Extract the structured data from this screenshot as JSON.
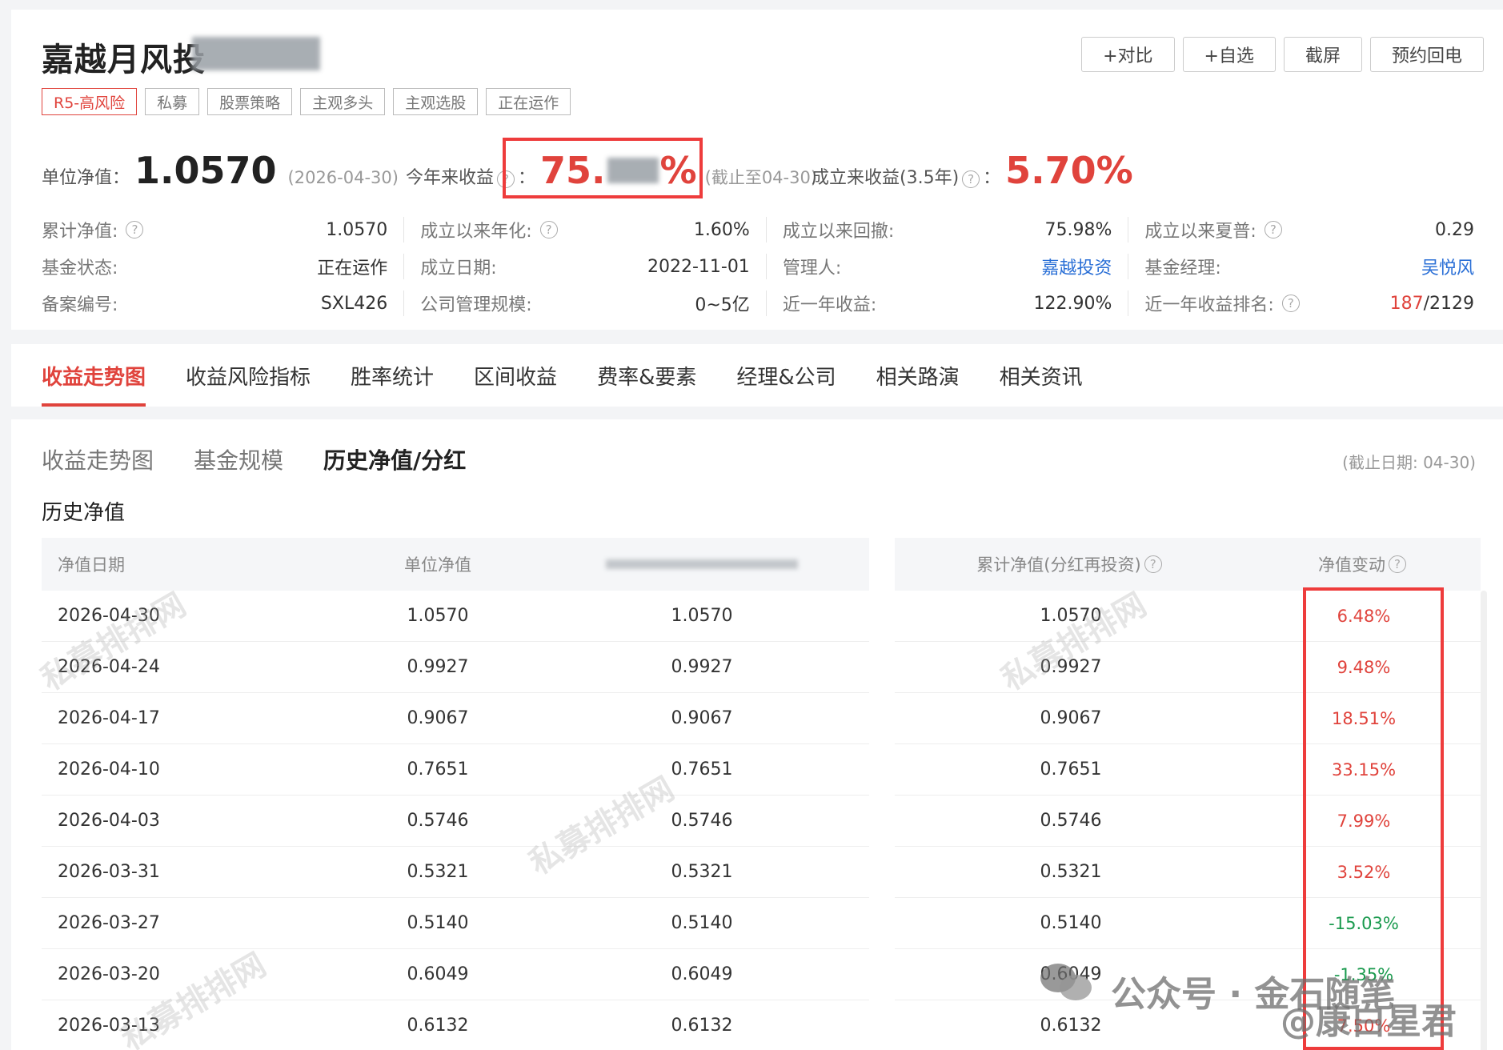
{
  "header": {
    "fund_title": "嘉越月风投",
    "buttons": [
      "+对比",
      "+自选",
      "截屏",
      "预约回电"
    ],
    "tags": [
      "R5-高风险",
      "私募",
      "股票策略",
      "主观多头",
      "主观选股",
      "正在运作"
    ]
  },
  "summary": {
    "nav_label": "单位净值：",
    "nav_value": "1.0570",
    "nav_date": "(2026-04-30)",
    "ytd_label": "今年来收益",
    "ytd_value_prefix": "75.",
    "ytd_value_suffix": "%",
    "ytd_date": "(截止至04-30)",
    "since_label": "成立来收益(3.5年)",
    "since_value": "5.70%",
    "colon": "："
  },
  "stats": [
    [
      {
        "k": "累计净值:",
        "v": "1.0570",
        "q": true
      },
      {
        "k": "成立以来年化:",
        "v": "1.60%",
        "q": true,
        "color": "red"
      },
      {
        "k": "成立以来回撤:",
        "v": "75.98%"
      },
      {
        "k": "成立以来夏普:",
        "v": "0.29",
        "q": true
      }
    ],
    [
      {
        "k": "基金状态:",
        "v": "正在运作"
      },
      {
        "k": "成立日期:",
        "v": "2022-11-01"
      },
      {
        "k": "管理人:",
        "v": "嘉越投资",
        "color": "link"
      },
      {
        "k": "基金经理:",
        "v": "吴悦风",
        "color": "link"
      }
    ],
    [
      {
        "k": "备案编号:",
        "v": "SXL426"
      },
      {
        "k": "公司管理规模:",
        "v": "0~5亿"
      },
      {
        "k": "近一年收益:",
        "v": "122.90%",
        "color": "red"
      },
      {
        "k": "近一年收益排名:",
        "v_red": "187",
        "v_rest": "/2129",
        "q": true
      }
    ]
  ],
  "tabs": [
    "收益走势图",
    "收益风险指标",
    "胜率统计",
    "区间收益",
    "费率&要素",
    "经理&公司",
    "相关路演",
    "相关资讯"
  ],
  "subtabs": [
    "收益走势图",
    "基金规模",
    "历史净值/分红"
  ],
  "asof": "(截止日期: 04-30)",
  "section_title": "历史净值",
  "table": {
    "headers": {
      "date": "净值日期",
      "nav": "单位净值",
      "acc": "累计净值(分红再投资)",
      "chg": "净值变动"
    },
    "rows": [
      {
        "date": "2026-04-30",
        "nav": "1.0570",
        "nav2": "1.0570",
        "acc": "1.0570",
        "chg": "6.48%",
        "dir": "up"
      },
      {
        "date": "2026-04-24",
        "nav": "0.9927",
        "nav2": "0.9927",
        "acc": "0.9927",
        "chg": "9.48%",
        "dir": "up"
      },
      {
        "date": "2026-04-17",
        "nav": "0.9067",
        "nav2": "0.9067",
        "acc": "0.9067",
        "chg": "18.51%",
        "dir": "up"
      },
      {
        "date": "2026-04-10",
        "nav": "0.7651",
        "nav2": "0.7651",
        "acc": "0.7651",
        "chg": "33.15%",
        "dir": "up"
      },
      {
        "date": "2026-04-03",
        "nav": "0.5746",
        "nav2": "0.5746",
        "acc": "0.5746",
        "chg": "7.99%",
        "dir": "up"
      },
      {
        "date": "2026-03-31",
        "nav": "0.5321",
        "nav2": "0.5321",
        "acc": "0.5321",
        "chg": "3.52%",
        "dir": "up"
      },
      {
        "date": "2026-03-27",
        "nav": "0.5140",
        "nav2": "0.5140",
        "acc": "0.5140",
        "chg": "-15.03%",
        "dir": "down"
      },
      {
        "date": "2026-03-20",
        "nav": "0.6049",
        "nav2": "0.6049",
        "acc": "0.6049",
        "chg": "-1.35%",
        "dir": "down"
      },
      {
        "date": "2026-03-13",
        "nav": "0.6132",
        "nav2": "0.6132",
        "acc": "0.6132",
        "chg": "7.50%",
        "dir": "up"
      }
    ]
  },
  "watermark_text": "私募排排网",
  "overlay": {
    "wechat": "公众号 · 金石随笔",
    "weibo": "@康白星君"
  },
  "colors": {
    "red": "#e0433c",
    "green": "#1a9a4e",
    "link": "#2a6fd6",
    "annotation": "#ee3c3c"
  }
}
